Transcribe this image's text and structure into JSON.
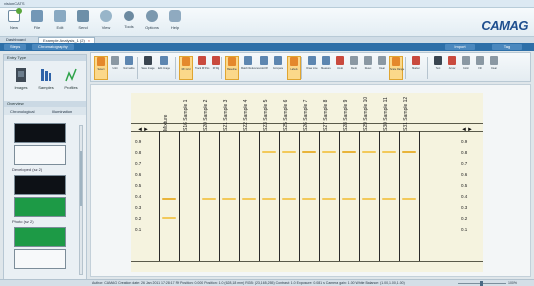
{
  "window": {
    "title": "visionCATS"
  },
  "ribbon": {
    "buttons": [
      {
        "label": "New",
        "icon": "new-icon"
      },
      {
        "label": "File",
        "icon": "file-icon"
      },
      {
        "label": "Edit",
        "icon": "edit-icon"
      },
      {
        "label": "Send",
        "icon": "send-icon"
      },
      {
        "label": "View",
        "icon": "view-icon"
      },
      {
        "label": "Tools",
        "icon": "tools-icon"
      },
      {
        "label": "Options",
        "icon": "options-icon"
      },
      {
        "label": "Help",
        "icon": "help-icon"
      }
    ],
    "brand": "CAMAG"
  },
  "tabs": [
    {
      "label": "Dashboard"
    },
    {
      "label": "Example Analysis_1 (2)",
      "close": "×",
      "active": true
    }
  ],
  "nav": {
    "crumbs": [
      "Steps",
      "Chromatography"
    ],
    "right_buttons": [
      "Import",
      "Tag"
    ]
  },
  "left_panel": {
    "entry_type_header": "Entry Type",
    "entry_types": [
      "Images",
      "Samples",
      "Profiles"
    ],
    "overview_header": "Overview",
    "overview_tabs": [
      "Chronological",
      "Illumination"
    ],
    "captions": [
      "Developed (sz 2)",
      "Photo (sz 2)"
    ]
  },
  "toolbar": {
    "buttons": [
      {
        "label": "Select",
        "color": "orange",
        "selected": true
      },
      {
        "label": "Uniti",
        "color": "gray"
      },
      {
        "label": "Normalize",
        "color": "blue"
      },
      {
        "label": "Save Image",
        "color": "dark"
      },
      {
        "label": "Edit Image",
        "color": "blue"
      },
      {
        "label": "RF Grid",
        "color": "orange",
        "selected": true
      },
      {
        "label": "Track Rf Pos",
        "color": "red"
      },
      {
        "label": "Rf Rg",
        "color": "red"
      },
      {
        "label": "Baseline",
        "color": "orange",
        "selected": true
      },
      {
        "label": "Match Reference",
        "color": "blue"
      },
      {
        "label": "Add Rf",
        "color": "blue"
      },
      {
        "label": "Compare",
        "color": "blue"
      },
      {
        "label": "Labels",
        "color": "orange",
        "selected": true
      },
      {
        "label": "Draw Line",
        "color": "blue"
      },
      {
        "label": "Measure",
        "color": "blue"
      },
      {
        "label": "Undo",
        "color": "red"
      },
      {
        "label": "Redo",
        "color": "gray"
      },
      {
        "label": "Reset",
        "color": "gray"
      },
      {
        "label": "Clear",
        "color": "gray"
      },
      {
        "label": "Scale Range",
        "color": "orange",
        "selected": true
      },
      {
        "label": "Marker",
        "color": "red"
      },
      {
        "label": "Text",
        "color": "dark"
      },
      {
        "label": "Arrow",
        "color": "red"
      },
      {
        "label": "Color",
        "color": "gray"
      },
      {
        "label": "Fill",
        "color": "gray"
      },
      {
        "label": "Clear",
        "color": "gray"
      }
    ]
  },
  "plate": {
    "lanes": [
      "Mixture",
      "S16",
      "Sample 1",
      "S20",
      "Sample 2",
      "S21",
      "Sample 3",
      "S22",
      "Sample 4",
      "S23",
      "Sample 5",
      "S25",
      "Sample 6",
      "S26",
      "Sample 7",
      "S27",
      "Sample 8",
      "S28",
      "Sample 9",
      "S29",
      "Sample 10",
      "S30",
      "Sample 11",
      "S31",
      "Sample 12"
    ],
    "lane_labels": [
      "Mixture",
      "S16 Sample 1",
      "S20 Sample 2",
      "S21 Sample 3",
      "S22 Sample 4",
      "S23 Sample 5",
      "S25 Sample 6",
      "S26 Sample 7",
      "S27 Sample 8",
      "S28 Sample 9",
      "S29 Sample 10",
      "S30 Sample 11",
      "S31 Sample 12"
    ],
    "rf_ticks": [
      "0.9",
      "0.8",
      "0.7",
      "0.6",
      "0.5",
      "0.4",
      "0.3",
      "0.2",
      "0.1"
    ],
    "band_color": "#f2c95a",
    "band_color_strong": "#e8b43a"
  },
  "status": {
    "text": "Author: CAMAG   Creation date: 26 Jan 2011 17:28:17   Rf Position: 0.000   Position: 1.0 (628,18 mm)   RGB: (23,165,255)   Contrast: 1.0   Exposure: 0.081 s   Camera gain: 1.00   White Balance: (1.00,1.00,1.00)",
    "zoom": "100%"
  }
}
